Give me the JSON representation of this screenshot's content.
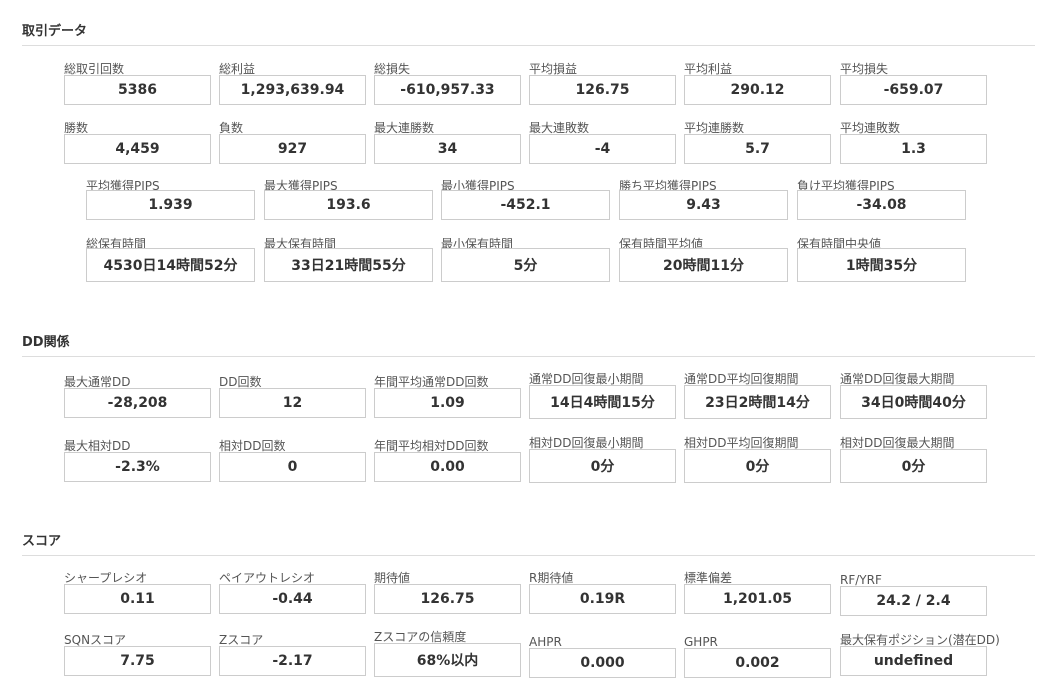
{
  "trade": {
    "title": "取引データ",
    "row1": [
      {
        "label": "総取引回数",
        "value": "5386"
      },
      {
        "label": "総利益",
        "value": "1,293,639.94"
      },
      {
        "label": "総損失",
        "value": "-610,957.33"
      },
      {
        "label": "平均損益",
        "value": "126.75"
      },
      {
        "label": "平均利益",
        "value": "290.12"
      },
      {
        "label": "平均損失",
        "value": "-659.07"
      }
    ],
    "row2": [
      {
        "label": "勝数",
        "value": "4,459"
      },
      {
        "label": "負数",
        "value": "927"
      },
      {
        "label": "最大連勝数",
        "value": "34"
      },
      {
        "label": "最大連敗数",
        "value": "-4"
      },
      {
        "label": "平均連勝数",
        "value": "5.7"
      },
      {
        "label": "平均連敗数",
        "value": "1.3"
      }
    ],
    "row3": [
      {
        "label": "平均獲得PIPS",
        "value": "1.939"
      },
      {
        "label": "最大獲得PIPS",
        "value": "193.6"
      },
      {
        "label": "最小獲得PIPS",
        "value": "-452.1"
      },
      {
        "label": "勝ち平均獲得PIPS",
        "value": "9.43"
      },
      {
        "label": "負け平均獲得PIPS",
        "value": "-34.08"
      }
    ],
    "row4": [
      {
        "label": "総保有時間",
        "value": "4530日14時間52分"
      },
      {
        "label": "最大保有時間",
        "value": "33日21時間55分"
      },
      {
        "label": "最小保有時間",
        "value": "5分"
      },
      {
        "label": "保有時間平均値",
        "value": "20時間11分"
      },
      {
        "label": "保有時間中央値",
        "value": "1時間35分"
      }
    ]
  },
  "dd": {
    "title": "DD関係",
    "row1": [
      {
        "label": "最大通常DD",
        "value": "-28,208"
      },
      {
        "label": "DD回数",
        "value": "12"
      },
      {
        "label": "年間平均通常DD回数",
        "value": "1.09"
      },
      {
        "label": "通常DD回復最小期間",
        "value": "14日4時間15分"
      },
      {
        "label": "通常DD平均回復期間",
        "value": "23日2時間14分"
      },
      {
        "label": "通常DD回復最大期間",
        "value": "34日0時間40分"
      }
    ],
    "row2": [
      {
        "label": "最大相対DD",
        "value": "-2.3%"
      },
      {
        "label": "相対DD回数",
        "value": "0"
      },
      {
        "label": "年間平均相対DD回数",
        "value": "0.00"
      },
      {
        "label": "相対DD回復最小期間",
        "value": "0分"
      },
      {
        "label": "相対DD平均回復期間",
        "value": "0分"
      },
      {
        "label": "相対DD回復最大期間",
        "value": "0分"
      }
    ]
  },
  "score": {
    "title": "スコア",
    "row1": [
      {
        "label": "シャープレシオ",
        "value": "0.11"
      },
      {
        "label": "ペイアウトレシオ",
        "value": "-0.44"
      },
      {
        "label": "期待値",
        "value": "126.75"
      },
      {
        "label": "R期待値",
        "value": "0.19R"
      },
      {
        "label": "標準偏差",
        "value": "1,201.05"
      },
      {
        "label": "RF/YRF",
        "value": "24.2 / 2.4"
      }
    ],
    "row2": [
      {
        "label": "SQNスコア",
        "value": "7.75"
      },
      {
        "label": "Zスコア",
        "value": "-2.17"
      },
      {
        "label": "Zスコアの信頼度",
        "value": "68%以内"
      },
      {
        "label": "AHPR",
        "value": "0.000"
      },
      {
        "label": "GHPR",
        "value": "0.002"
      },
      {
        "label": "最大保有ポジション(潜在DD)",
        "value": "undefined"
      }
    ]
  }
}
